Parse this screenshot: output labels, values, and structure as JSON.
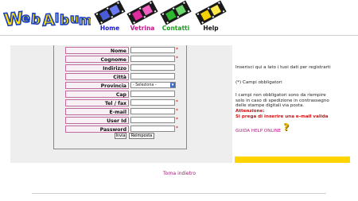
{
  "header": {
    "logo_text": "WebAlbum",
    "nav": [
      {
        "label": "Home",
        "color": "#1b1bd0"
      },
      {
        "label": "Vetrina",
        "color": "#c2138a"
      },
      {
        "label": "Contatti",
        "color": "#1c9a1c"
      },
      {
        "label": "Help",
        "color": "#111111"
      }
    ]
  },
  "form": {
    "fields": [
      {
        "label": "Nome",
        "required": "*"
      },
      {
        "label": "Cognome",
        "required": "*"
      },
      {
        "label": "Indirizzo",
        "required": ""
      },
      {
        "label": "Città",
        "required": ""
      },
      {
        "label": "Provincia",
        "required": ""
      },
      {
        "label": "Cap",
        "required": ""
      },
      {
        "label": "Tel / fax",
        "required": "*"
      },
      {
        "label": "E-mail",
        "required": "*"
      },
      {
        "label": "User Id",
        "required": "*"
      },
      {
        "label": "Password",
        "required": "*"
      }
    ],
    "provincia_selected": "- Seleziona -",
    "submit_label": "Invia",
    "reset_label": "Reimposta"
  },
  "info": {
    "intro": "Inserisci qui a lato i tuoi dati per registrarti",
    "required_note": "(*) Campi obbligatori",
    "optional_note": "I campi non obbligatori sono da riempire solo in caso di spedizione in contrassegno delle stampe digitali via posta.",
    "warning_title": "Attenzione:",
    "warning_text": "Si prega di inserire una e-mail valida",
    "help_link": "GUIDA HELP ONLINE"
  },
  "colors": {
    "accent": "#c2138a",
    "warning": "#d01010",
    "yellow": "#ffd400"
  },
  "back_link": "Torna indietro"
}
